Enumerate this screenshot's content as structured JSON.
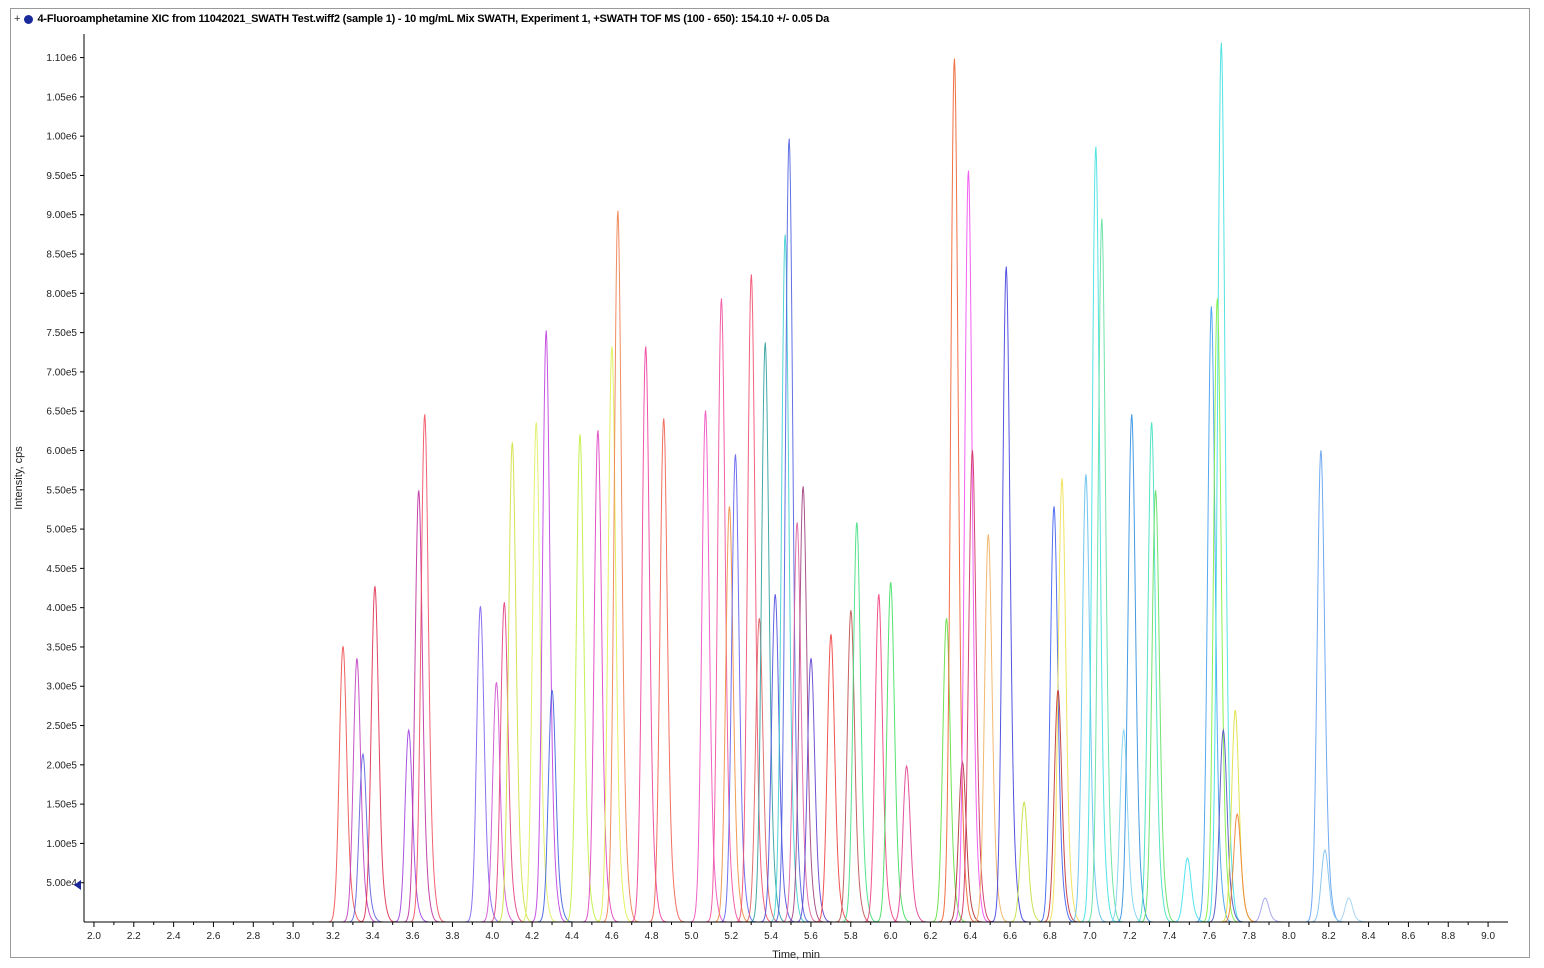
{
  "header": {
    "title": "4-Fluoroamphetamine XIC from 11042021_SWATH Test.wiff2 (sample 1) - 10 mg/mL Mix SWATH, Experiment 1, +SWATH TOF MS (100 - 650): 154.10 +/- 0.05 Da"
  },
  "chart_data": {
    "type": "line",
    "title": "",
    "xlabel": "Time, min",
    "ylabel": "Intensity, cps",
    "xlim": [
      1.95,
      9.1
    ],
    "ylim": [
      0,
      1130000.0
    ],
    "x_ticks": [
      2.0,
      2.2,
      2.4,
      2.6,
      2.8,
      3.0,
      3.2,
      3.4,
      3.6,
      3.8,
      4.0,
      4.2,
      4.4,
      4.6,
      4.8,
      5.0,
      5.2,
      5.4,
      5.6,
      5.8,
      6.0,
      6.2,
      6.4,
      6.6,
      6.8,
      7.0,
      7.2,
      7.4,
      7.6,
      7.8,
      8.0,
      8.2,
      8.4,
      8.6,
      8.8,
      9.0
    ],
    "x_tick_labels": [
      "2.0",
      "2.2",
      "2.4",
      "2.6",
      "2.8",
      "3.0",
      "3.2",
      "3.4",
      "3.6",
      "3.8",
      "4.0",
      "4.2",
      "4.4",
      "4.6",
      "4.8",
      "5.0",
      "5.2",
      "5.4",
      "5.6",
      "5.8",
      "6.0",
      "6.2",
      "6.4",
      "6.6",
      "6.8",
      "7.0",
      "7.2",
      "7.4",
      "7.6",
      "7.8",
      "8.0",
      "8.2",
      "8.4",
      "8.6",
      "8.8",
      "9.0"
    ],
    "y_ticks": [
      50000.0,
      100000.0,
      150000.0,
      200000.0,
      250000.0,
      300000.0,
      350000.0,
      400000.0,
      450000.0,
      500000.0,
      550000.0,
      600000.0,
      650000.0,
      700000.0,
      750000.0,
      800000.0,
      850000.0,
      900000.0,
      950000.0,
      1000000.0,
      1050000.0,
      1100000.0
    ],
    "y_tick_labels": [
      "5.00e4",
      "1.00e5",
      "1.50e5",
      "2.00e5",
      "2.50e5",
      "3.00e5",
      "3.50e5",
      "4.00e5",
      "4.50e5",
      "5.00e5",
      "5.50e5",
      "6.00e5",
      "6.50e5",
      "7.00e5",
      "7.50e5",
      "8.00e5",
      "8.50e5",
      "9.00e5",
      "9.50e5",
      "1.00e6",
      "1.05e6",
      "1.10e6"
    ],
    "grid": false,
    "legend": "none",
    "peaks": [
      {
        "rt": 3.25,
        "h": 345000.0,
        "c": "#f05050"
      },
      {
        "rt": 3.32,
        "h": 330000.0,
        "c": "#c040c0"
      },
      {
        "rt": 3.35,
        "h": 210000.0,
        "c": "#6060e0"
      },
      {
        "rt": 3.41,
        "h": 420000.0,
        "c": "#e03050"
      },
      {
        "rt": 3.58,
        "h": 240000.0,
        "c": "#a040e0"
      },
      {
        "rt": 3.63,
        "h": 540000.0,
        "c": "#c030a0"
      },
      {
        "rt": 3.66,
        "h": 635000.0,
        "c": "#f05060"
      },
      {
        "rt": 3.94,
        "h": 395000.0,
        "c": "#8060f0"
      },
      {
        "rt": 4.02,
        "h": 300000.0,
        "c": "#d050d0"
      },
      {
        "rt": 4.06,
        "h": 400000.0,
        "c": "#e04080"
      },
      {
        "rt": 4.1,
        "h": 600000.0,
        "c": "#d0e040"
      },
      {
        "rt": 4.22,
        "h": 625000.0,
        "c": "#e0f060"
      },
      {
        "rt": 4.27,
        "h": 740000.0,
        "c": "#c040e0"
      },
      {
        "rt": 4.3,
        "h": 290000.0,
        "c": "#4060e0"
      },
      {
        "rt": 4.44,
        "h": 610000.0,
        "c": "#c0f040"
      },
      {
        "rt": 4.53,
        "h": 615000.0,
        "c": "#e040c0"
      },
      {
        "rt": 4.6,
        "h": 720000.0,
        "c": "#e0f050"
      },
      {
        "rt": 4.63,
        "h": 890000.0,
        "c": "#f08050"
      },
      {
        "rt": 4.77,
        "h": 720000.0,
        "c": "#f040a0"
      },
      {
        "rt": 4.86,
        "h": 630000.0,
        "c": "#f06050"
      },
      {
        "rt": 5.07,
        "h": 640000.0,
        "c": "#f050c0"
      },
      {
        "rt": 5.15,
        "h": 780000.0,
        "c": "#f050a0"
      },
      {
        "rt": 5.19,
        "h": 520000.0,
        "c": "#f09040"
      },
      {
        "rt": 5.22,
        "h": 585000.0,
        "c": "#6060f0"
      },
      {
        "rt": 5.3,
        "h": 810000.0,
        "c": "#f05070"
      },
      {
        "rt": 5.34,
        "h": 380000.0,
        "c": "#e06060"
      },
      {
        "rt": 5.37,
        "h": 725000.0,
        "c": "#30a0a0"
      },
      {
        "rt": 5.42,
        "h": 410000.0,
        "c": "#5050e0"
      },
      {
        "rt": 5.47,
        "h": 860000.0,
        "c": "#40d0d0"
      },
      {
        "rt": 5.49,
        "h": 980000.0,
        "c": "#5060e0"
      },
      {
        "rt": 5.53,
        "h": 500000.0,
        "c": "#e060a0"
      },
      {
        "rt": 5.56,
        "h": 545000.0,
        "c": "#a04080"
      },
      {
        "rt": 5.6,
        "h": 330000.0,
        "c": "#6040d0"
      },
      {
        "rt": 5.7,
        "h": 360000.0,
        "c": "#f04040"
      },
      {
        "rt": 5.8,
        "h": 390000.0,
        "c": "#c05050"
      },
      {
        "rt": 5.83,
        "h": 500000.0,
        "c": "#40e080"
      },
      {
        "rt": 5.94,
        "h": 410000.0,
        "c": "#f04080"
      },
      {
        "rt": 6.0,
        "h": 425000.0,
        "c": "#40e060"
      },
      {
        "rt": 6.08,
        "h": 195000.0,
        "c": "#e04090"
      },
      {
        "rt": 6.28,
        "h": 380000.0,
        "c": "#60e040"
      },
      {
        "rt": 6.32,
        "h": 1080000.0,
        "c": "#f06030"
      },
      {
        "rt": 6.36,
        "h": 200000.0,
        "c": "#b03030"
      },
      {
        "rt": 6.39,
        "h": 940000.0,
        "c": "#f050f0"
      },
      {
        "rt": 6.41,
        "h": 590000.0,
        "c": "#d03060"
      },
      {
        "rt": 6.49,
        "h": 485000.0,
        "c": "#f0b060"
      },
      {
        "rt": 6.58,
        "h": 820000.0,
        "c": "#4040e0"
      },
      {
        "rt": 6.67,
        "h": 150000.0,
        "c": "#c0e040"
      },
      {
        "rt": 6.82,
        "h": 520000.0,
        "c": "#4060f0"
      },
      {
        "rt": 6.86,
        "h": 555000.0,
        "c": "#f0e050"
      },
      {
        "rt": 6.84,
        "h": 290000.0,
        "c": "#c03030"
      },
      {
        "rt": 6.98,
        "h": 560000.0,
        "c": "#60c0f0"
      },
      {
        "rt": 7.03,
        "h": 970000.0,
        "c": "#40e0e0"
      },
      {
        "rt": 7.06,
        "h": 880000.0,
        "c": "#60e0a0"
      },
      {
        "rt": 7.17,
        "h": 240000.0,
        "c": "#80d0f0"
      },
      {
        "rt": 7.21,
        "h": 635000.0,
        "c": "#3090e0"
      },
      {
        "rt": 7.31,
        "h": 625000.0,
        "c": "#40e0c0"
      },
      {
        "rt": 7.33,
        "h": 540000.0,
        "c": "#60e060"
      },
      {
        "rt": 7.49,
        "h": 80000.0,
        "c": "#40e0f0"
      },
      {
        "rt": 7.61,
        "h": 770000.0,
        "c": "#40a0f0"
      },
      {
        "rt": 7.66,
        "h": 1100000.0,
        "c": "#40e0e0"
      },
      {
        "rt": 7.64,
        "h": 780000.0,
        "c": "#80f040"
      },
      {
        "rt": 7.67,
        "h": 240000.0,
        "c": "#5050c0"
      },
      {
        "rt": 7.73,
        "h": 265000.0,
        "c": "#e0e040"
      },
      {
        "rt": 7.74,
        "h": 135000.0,
        "c": "#f08030"
      },
      {
        "rt": 7.88,
        "h": 30000.0,
        "c": "#a0a0f0"
      },
      {
        "rt": 8.16,
        "h": 590000.0,
        "c": "#60a0f0"
      },
      {
        "rt": 8.18,
        "h": 90000.0,
        "c": "#80c0f0"
      },
      {
        "rt": 8.3,
        "h": 30000.0,
        "c": "#a0d0f0"
      }
    ]
  }
}
